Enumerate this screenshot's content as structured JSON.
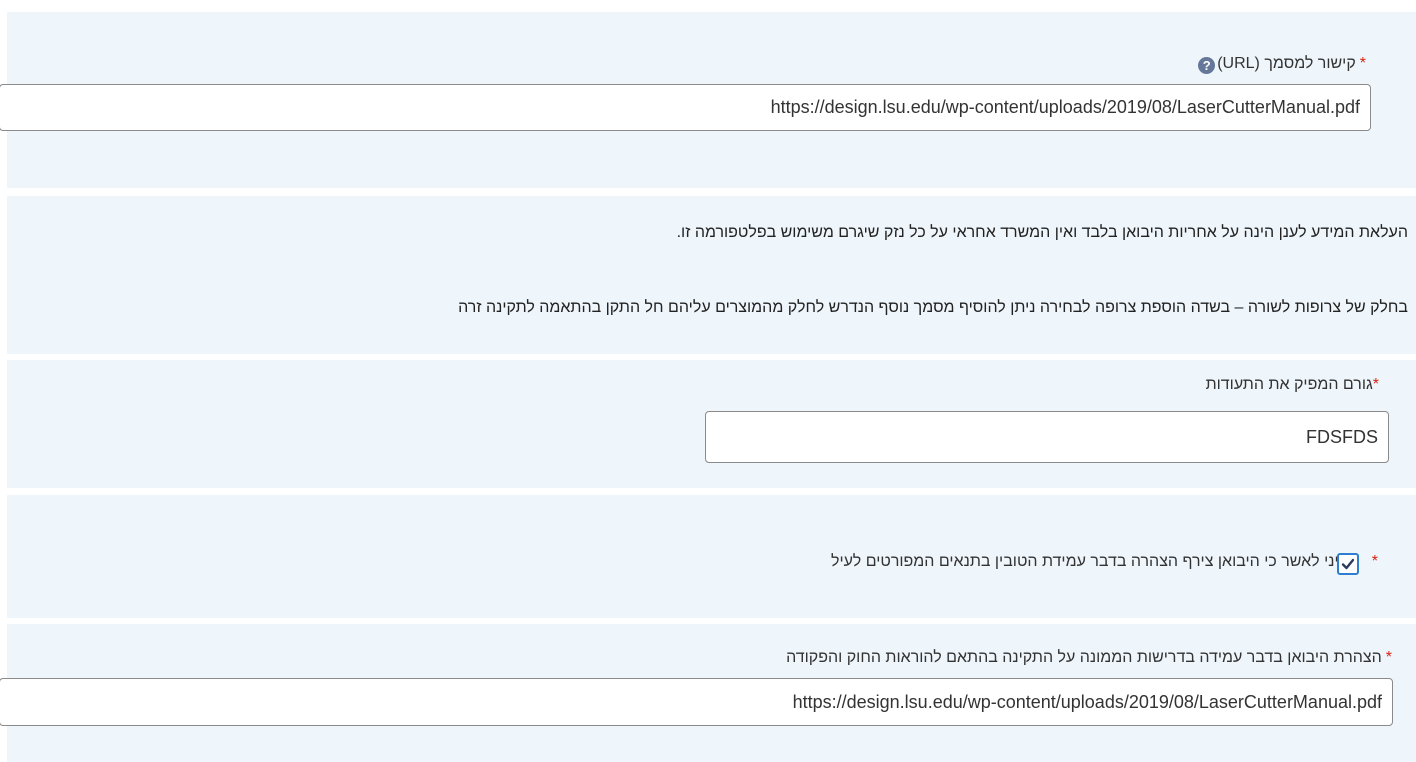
{
  "url_section": {
    "label": "קישור למסמך (URL)",
    "required_mark": "*",
    "help_icon_glyph": "?",
    "value": "https://design.lsu.edu/wp-content/uploads/2019/08/LaserCutterManual.pdf"
  },
  "notice_section": {
    "line1": "העלאת המידע לענן הינה על אחריות היבואן בלבד ואין המשרד אחראי על כל נזק שיגרם משימוש בפלטפורמה זו.",
    "line2": "בחלק של צרופות לשורה – בשדה הוספת צרופה לבחירה ניתן להוסיף מסמך נוסף הנדרש לחלק מהמוצרים עליהם חל התקן בהתאמה לתקינה זרה"
  },
  "issuer_section": {
    "label": "גורם המפיק את התעודות",
    "required_mark": "*",
    "value": "FDSFDS"
  },
  "confirm_section": {
    "label": "הריני לאשר כי היבואן צירף הצהרה בדבר עמידת הטובין בתנאים המפורטים לעיל",
    "required_mark": "*",
    "checked": true
  },
  "declaration_section": {
    "label": "הצהרת היבואן בדבר עמידה בדרישות הממונה על התקינה בהתאם להוראות החוק והפקודה",
    "required_mark": "*",
    "value": "https://design.lsu.edu/wp-content/uploads/2019/08/LaserCutterManual.pdf"
  },
  "colors": {
    "panel_bg": "#eef5fb",
    "required": "#d9230f",
    "checkbox_border": "#2f7fd1",
    "help_icon": "#65789a"
  }
}
